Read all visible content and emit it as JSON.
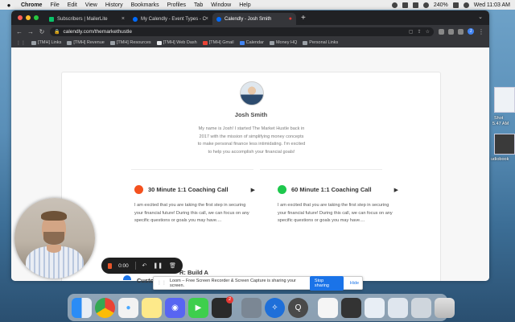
{
  "menubar": {
    "app": "Chrome",
    "items": [
      "File",
      "Edit",
      "View",
      "History",
      "Bookmarks",
      "Profiles",
      "Tab",
      "Window",
      "Help"
    ],
    "battery": "240%",
    "clock": "Wed 11:03 AM"
  },
  "browser": {
    "tabs": [
      {
        "title": "Subscribers | MailerLite",
        "color": "#09c269"
      },
      {
        "title": "My Calendly - Event Types - C",
        "color": "#006bff"
      },
      {
        "title": "Calendly - Josh Smith",
        "color": "#006bff"
      }
    ],
    "url": "calendly.com/themarkethustle",
    "profile_initial": "J",
    "bookmarks": [
      "[TMH] Links",
      "[TMH] Revenue",
      "[TMH] Resources",
      "[TMH] Web Dash",
      "[TMH] Gmail",
      "Calendar",
      "Money HQ",
      "Personal Links"
    ]
  },
  "page": {
    "name": "Josh Smith",
    "bio": "My name is Josh! I started The Market Hustle back in 2017 with the mission of simplifying money concepts to make personal finance less intimidating. I'm excited to help you accomplish your financial goals!",
    "events": [
      {
        "title": "30 Minute 1:1 Coaching Call",
        "color": "#f4511e",
        "description": "I am excited that you are taking the first step in securing your financial future! During this call, we can focus on any specific questions or goals you may have...."
      },
      {
        "title": "60 Minute 1:1 Coaching Call",
        "color": "#1ec84d",
        "description": "I am excited that you are taking the first step in securing your financial future! During this call, we can focus on any specific questions or goals you may have...."
      }
    ],
    "partial_title": "R: Build A",
    "partial_left": "Custo"
  },
  "loom": {
    "timer": "0:00",
    "share_message": "Loom – Free Screen Recorder & Screen Capture is sharing your screen.",
    "stop_label": "Stop sharing",
    "hide_label": "Hide"
  },
  "desktop": {
    "labels": [
      "Shot",
      "5.47 AM",
      "udiobook"
    ]
  },
  "dock": {
    "badge": "2"
  }
}
